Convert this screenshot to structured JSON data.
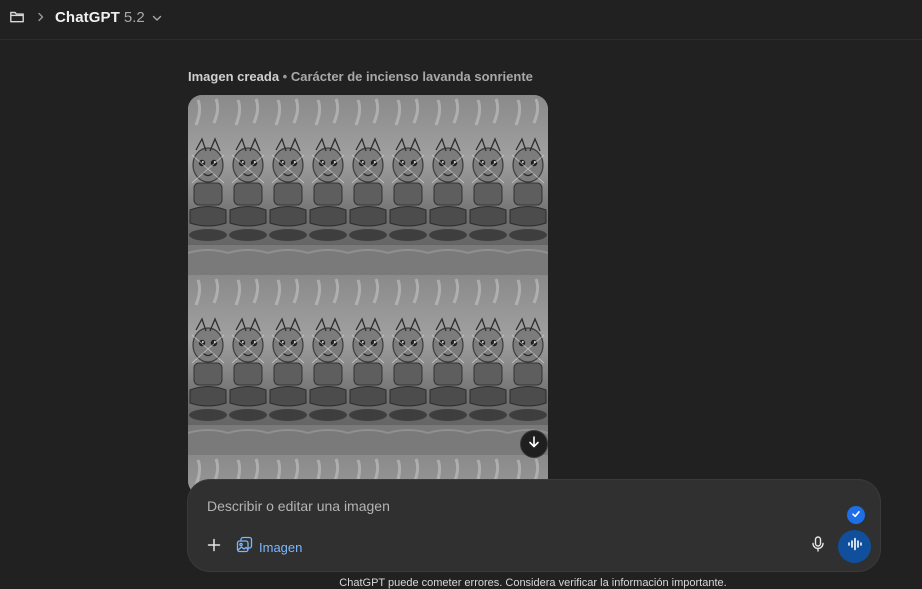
{
  "header": {
    "model_name": "ChatGPT",
    "model_version": "5.2"
  },
  "message": {
    "caption_title": "Imagen creada",
    "caption_separator": "•",
    "caption_subtitle": "Carácter de incienso lavanda sonriente"
  },
  "composer": {
    "placeholder": "Describir o editar una imagen",
    "image_tool_label": "Imagen"
  },
  "footer": {
    "disclaimer": "ChatGPT puede cometer errores. Considera verificar la información importante."
  },
  "colors": {
    "background": "#212121",
    "composer_bg": "#303030",
    "accent_blue": "#7ab7ff",
    "voice_button": "#0f4f9c",
    "check_badge": "#1e6ee8"
  },
  "icons": {
    "folder": "folder-icon",
    "breadcrumb_chevron": "chevron-right-icon",
    "model_chevron": "chevron-down-icon",
    "download": "arrow-down-icon",
    "plus": "plus-icon",
    "image_tool": "image-icon",
    "check": "check-icon",
    "mic": "microphone-icon",
    "voice": "voice-waveform-icon"
  }
}
